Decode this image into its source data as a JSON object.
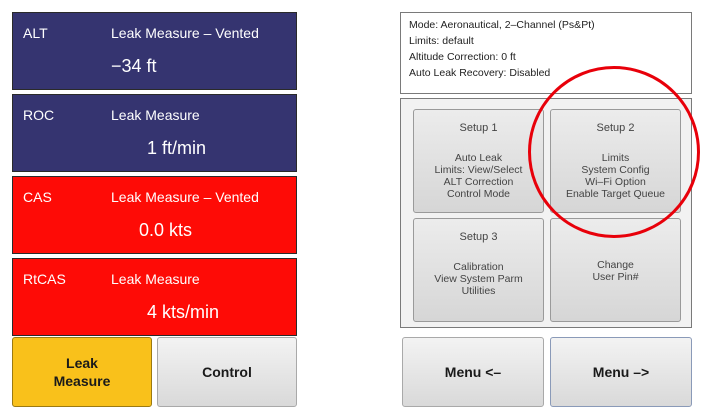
{
  "channels": [
    {
      "name": "ALT",
      "status": "Leak Measure – Vented",
      "value": "−34 ft",
      "color": "#353470"
    },
    {
      "name": "ROC",
      "status": "Leak Measure",
      "value": "1 ft/min",
      "color": "#353470"
    },
    {
      "name": "CAS",
      "status": "Leak Measure – Vented",
      "value": "0.0 kts",
      "color": "#fe0b06"
    },
    {
      "name": "RtCAS",
      "status": "Leak Measure",
      "value": "4 kts/min",
      "color": "#fe0b06"
    }
  ],
  "buttons": {
    "leak_measure_line1": "Leak",
    "leak_measure_line2": "Measure",
    "control": "Control",
    "menu_back": "Menu <–",
    "menu_forward": "Menu –>"
  },
  "info": {
    "mode": "Mode: Aeronautical, 2–Channel (Ps&Pt)",
    "limits": "Limits: default",
    "altitude_correction": "Altitude Correction: 0 ft",
    "auto_leak_recovery": "Auto Leak Recovery: Disabled"
  },
  "setup": {
    "setup1": {
      "title": "Setup 1",
      "lines": [
        "Auto Leak",
        "Limits: View/Select",
        "ALT Correction",
        "Control Mode"
      ]
    },
    "setup2": {
      "title": "Setup 2",
      "lines": [
        "Limits",
        "System Config",
        "Wi–Fi Option",
        "Enable Target Queue"
      ]
    },
    "setup3": {
      "title": "Setup 3",
      "lines": [
        "Calibration",
        "View System Parm",
        "Utilities"
      ]
    },
    "change_pin": {
      "lines": [
        "Change",
        "User Pin#"
      ]
    }
  },
  "colors": {
    "navy_panel": "#353470",
    "red_panel": "#fe0b06",
    "active_button": "#f9c11b",
    "annotation": "#e8000a"
  }
}
